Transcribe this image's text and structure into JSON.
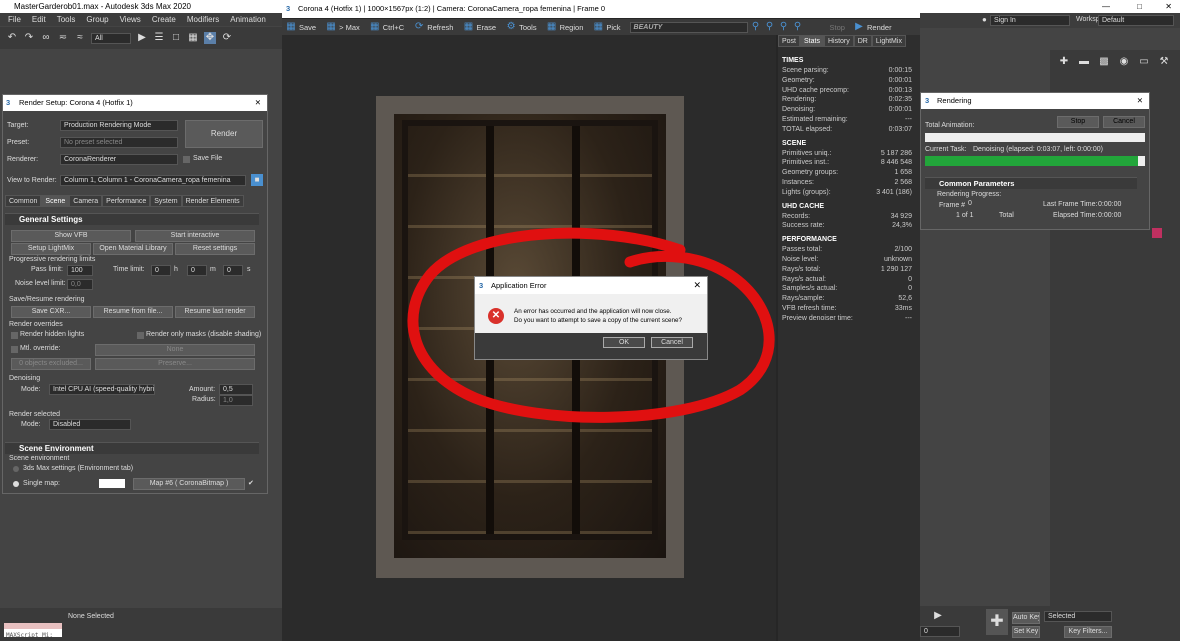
{
  "max": {
    "title": "MasterGarderob01.max - Autodesk 3ds Max 2020",
    "menu": [
      "File",
      "Edit",
      "Tools",
      "Group",
      "Views",
      "Create",
      "Modifiers",
      "Animation"
    ],
    "selection": "All",
    "sign_in": "Sign In",
    "workspaces_label": "Workspaces:",
    "workspace": "Default",
    "maxscript": "MAXScript Mi:",
    "status": "None Selected",
    "auto_key": "Auto Key",
    "set_key": "Set Key",
    "selected": "Selected",
    "key_filters": "Key Filters...",
    "frame": "0"
  },
  "render_setup": {
    "title": "Render Setup: Corona 4 (Hotfix 1)",
    "target_label": "Target:",
    "target": "Production Rendering Mode",
    "preset_label": "Preset:",
    "preset": "No preset selected",
    "renderer_label": "Renderer:",
    "renderer": "CoronaRenderer",
    "save_file": "Save File",
    "view_label": "View to Render:",
    "view": "Column 1, Column 1 - CoronaCamera_ropa femenina",
    "render_btn": "Render",
    "tabs": [
      "Common",
      "Scene",
      "Camera",
      "Performance",
      "System",
      "Render Elements"
    ],
    "general_settings": "General Settings",
    "show_vfb": "Show VFB",
    "start_interactive": "Start interactive",
    "setup_lightmix": "Setup LightMix",
    "open_material_library": "Open Material Library",
    "reset_settings": "Reset settings",
    "progressive": "Progressive rendering limits",
    "pass_limit_label": "Pass limit:",
    "pass_limit": "100",
    "time_limit_label": "Time limit:",
    "h": "h",
    "m": "m",
    "s": "s",
    "t0": "0",
    "noise_label": "Noise level limit:",
    "noise": "0,0",
    "save_resume": "Save/Resume rendering",
    "save_cxr": "Save CXR...",
    "resume_from_file": "Resume from file...",
    "resume_last": "Resume last render",
    "overrides": "Render overrides",
    "hidden_lights": "Render hidden lights",
    "only_masks": "Render only masks (disable shading)",
    "mtl_override": "Mtl. override:",
    "none": "None",
    "objects_excluded": "0 objects excluded...",
    "preserve": "Preserve...",
    "denoising": "Denoising",
    "mode_label": "Mode:",
    "denoise_mode": "Intel CPU AI (speed-quality hybrid)",
    "amount_label": "Amount:",
    "amount": "0,5",
    "radius_label": "Radius:",
    "radius": "1,0",
    "render_selected": "Render selected",
    "rs_mode": "Disabled",
    "scene_environment": "Scene Environment",
    "scene_env": "Scene environment",
    "max_settings": "3ds Max settings (Environment tab)",
    "single_map": "Single map:",
    "map": "Map #6 ( CoronaBitmap )"
  },
  "vfb": {
    "title": "Corona 4 (Hotfix 1) | 1000×1567px (1:2) | Camera: CoronaCamera_ropa femenina | Frame 0",
    "toolbar": [
      "Save",
      "> Max",
      "Ctrl+C",
      "Refresh",
      "Erase",
      "Tools",
      "Region",
      "Pick"
    ],
    "beauty": "BEAUTY",
    "stop": "Stop",
    "render": "Render",
    "tabs": [
      "Post",
      "Stats",
      "History",
      "DR",
      "LightMix"
    ],
    "stats": [
      {
        "head": "TIMES",
        "rows": [
          [
            "Scene parsing:",
            "0:00:15"
          ],
          [
            "Geometry:",
            "0:00:01"
          ],
          [
            "UHD cache precomp:",
            "0:00:13"
          ],
          [
            "Rendering:",
            "0:02:35"
          ],
          [
            "Denoising:",
            "0:00:01"
          ],
          [
            "Estimated remaining:",
            "---"
          ],
          [
            "TOTAL elapsed:",
            "0:03:07"
          ]
        ]
      },
      {
        "head": "SCENE",
        "rows": [
          [
            "Primitives uniq.:",
            "5 187 286"
          ],
          [
            "Primitives inst.:",
            "8 446 548"
          ],
          [
            "Geometry groups:",
            "1 658"
          ],
          [
            "Instances:",
            "2 568"
          ],
          [
            "Lights (groups):",
            "3 401 (186)"
          ]
        ]
      },
      {
        "head": "UHD CACHE",
        "rows": [
          [
            "Records:",
            "34 929"
          ],
          [
            "Success rate:",
            "24,3%"
          ]
        ]
      },
      {
        "head": "PERFORMANCE",
        "rows": [
          [
            "Passes total:",
            "2/100"
          ],
          [
            "Noise level:",
            "unknown"
          ],
          [
            "Rays/s total:",
            "1 290 127"
          ],
          [
            "Rays/s actual:",
            "0"
          ],
          [
            "Samples/s actual:",
            "0"
          ],
          [
            "Rays/sample:",
            "52,6"
          ],
          [
            "VFB refresh time:",
            "33ms"
          ],
          [
            "Preview denoiser time:",
            "---"
          ]
        ]
      }
    ]
  },
  "rendering": {
    "title": "Rendering",
    "total_animation": "Total Animation:",
    "stop": "Stop",
    "cancel": "Cancel",
    "current_task": "Current Task:",
    "task": "Denoising (elapsed: 0:03:07, left: 0:00:00)",
    "common_params": "Common Parameters",
    "progress": "Rendering Progress:",
    "frame_label": "Frame #",
    "frame": "0",
    "of": "1 of 1",
    "total": "Total",
    "last_frame": "Last Frame Time:",
    "last_frame_val": "0:00:00",
    "elapsed": "Elapsed Time:",
    "elapsed_val": "0:00:00",
    "progress_value": 0.97
  },
  "error": {
    "title": "Application Error",
    "line1": "An error has occurred and the application will now close.",
    "line2": "Do you want to attempt to save a copy of the current scene?",
    "ok": "OK",
    "cancel": "Cancel"
  },
  "colors": {
    "annotation": "#e01010",
    "error_icon": "#d9312b",
    "progress": "#22a53a"
  }
}
